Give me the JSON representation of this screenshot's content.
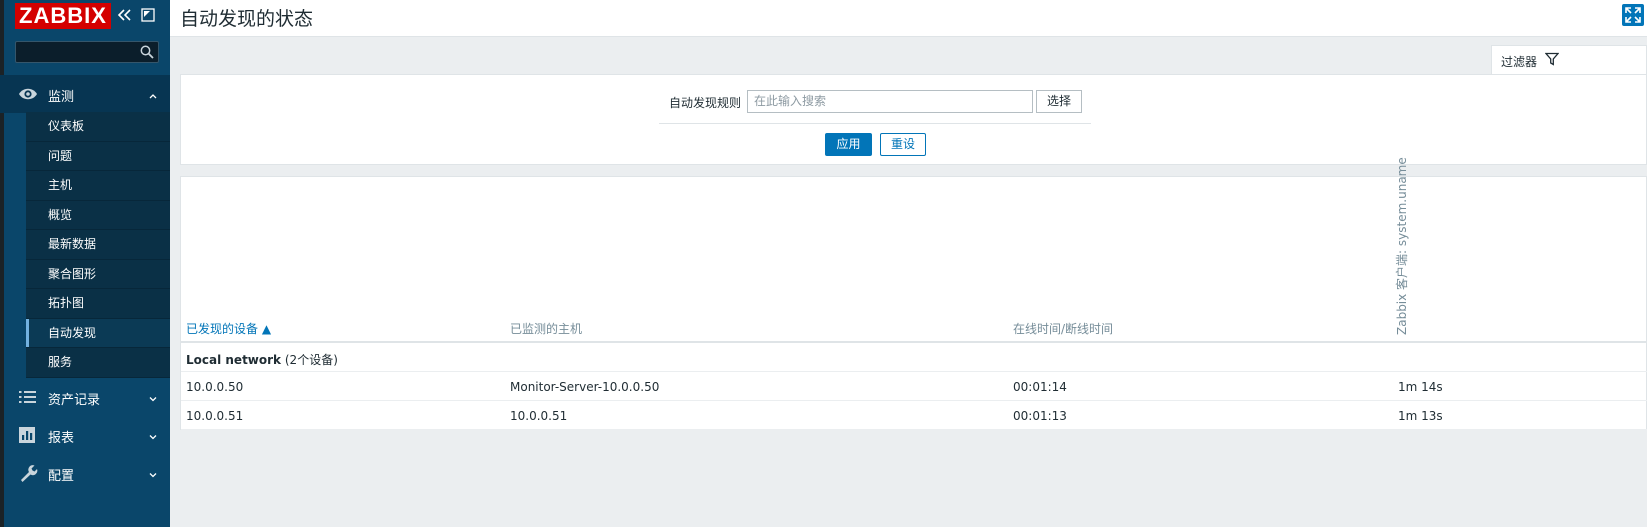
{
  "sidebar": {
    "logo": "ZABBIX",
    "search_placeholder": "",
    "sections": [
      {
        "label": "监测",
        "icon": "eye-icon",
        "expanded": true
      },
      {
        "label": "资产记录",
        "icon": "list-icon",
        "expanded": false
      },
      {
        "label": "报表",
        "icon": "report-icon",
        "expanded": false
      },
      {
        "label": "配置",
        "icon": "wrench-icon",
        "expanded": false
      }
    ],
    "submenu": [
      "仪表板",
      "问题",
      "主机",
      "概览",
      "最新数据",
      "聚合图形",
      "拓扑图",
      "自动发现",
      "服务"
    ],
    "selected_submenu": "自动发现"
  },
  "header": {
    "title": "自动发现的状态"
  },
  "filter": {
    "tab_label": "过滤器",
    "rule_label": "自动发现规则",
    "rule_placeholder": "在此输入搜索",
    "select_label": "选择",
    "apply_label": "应用",
    "reset_label": "重设"
  },
  "table": {
    "columns": {
      "discovered_device": "已发现的设备 ▲",
      "monitored_host": "已监测的主机",
      "uptime_downtime": "在线时间/断线时间",
      "check": "Zabbix 客户端: system.uname"
    },
    "group": {
      "name": "Local network",
      "count": "(2个设备)"
    },
    "rows": [
      {
        "device": "10.0.0.50",
        "host": "Monitor-Server-10.0.0.50",
        "uptime": "00:01:14",
        "check": "1m 14s"
      },
      {
        "device": "10.0.0.51",
        "host": "10.0.0.51",
        "uptime": "00:01:13",
        "check": "1m 13s"
      }
    ]
  },
  "colors": {
    "sidebar_bg": "#0a466a",
    "logo_bg": "#d40000",
    "accent": "#0275b8"
  }
}
